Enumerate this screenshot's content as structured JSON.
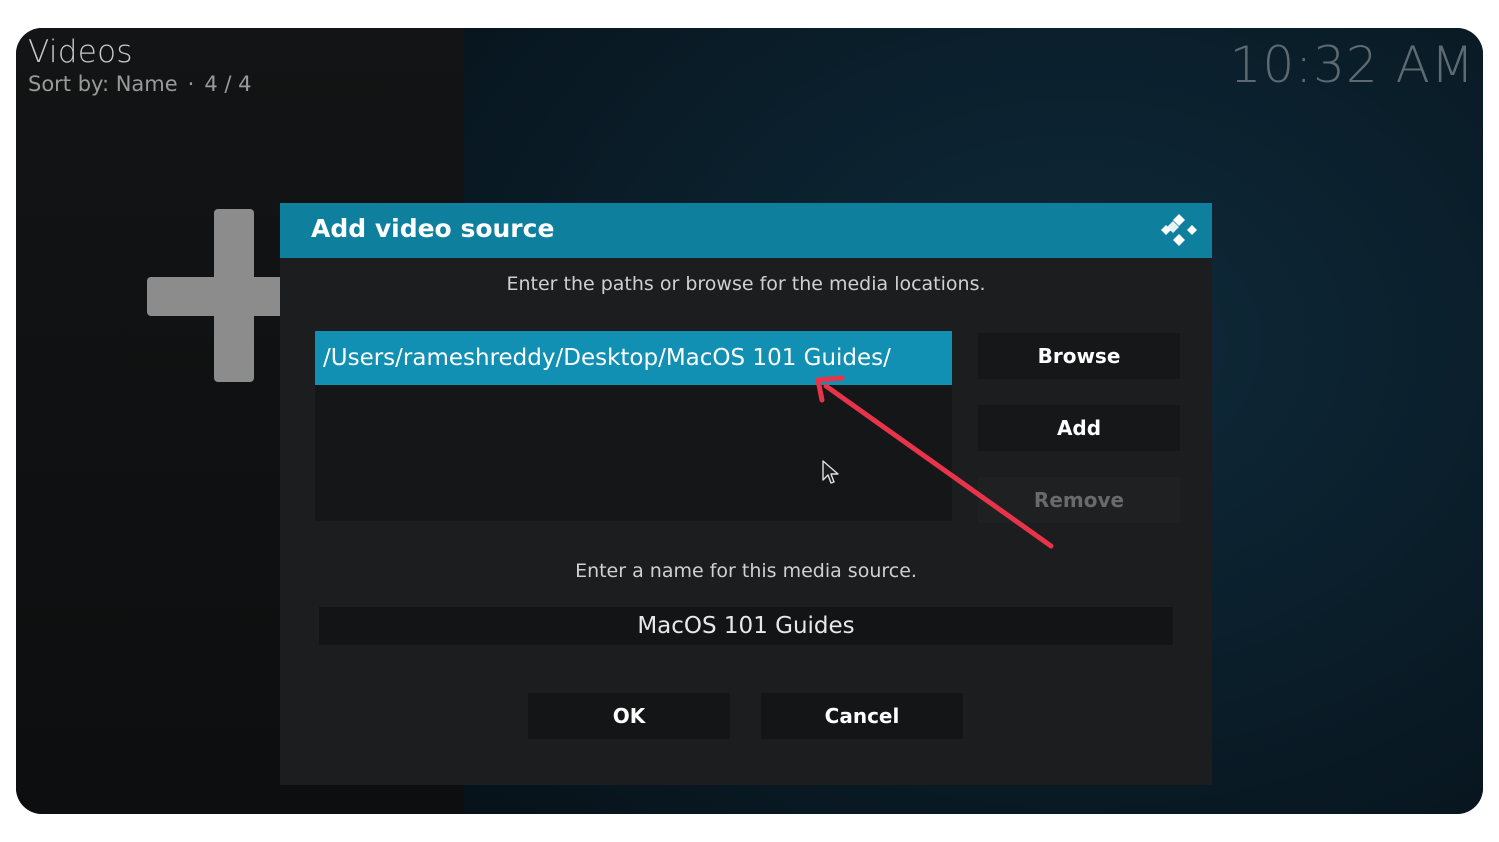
{
  "header": {
    "title": "Videos",
    "sort_label": "Sort by: Name",
    "separator": "·",
    "count": "4 / 4",
    "clock": "10:32 AM"
  },
  "dialog": {
    "title": "Add video source",
    "paths_instruction": "Enter the paths or browse for the media locations.",
    "paths": [
      "/Users/rameshreddy/Desktop/MacOS 101 Guides/"
    ],
    "browse_label": "Browse",
    "add_label": "Add",
    "remove_label": "Remove",
    "name_instruction": "Enter a name for this media source.",
    "name_value": "MacOS 101 Guides",
    "ok_label": "OK",
    "cancel_label": "Cancel"
  },
  "icons": {
    "add_source": "plus-icon",
    "logo": "kodi-logo-icon",
    "cursor": "mouse-pointer-icon",
    "annotation": "red-arrow-annotation"
  },
  "colors": {
    "accent": "#0e7f9c",
    "selected_item": "#1190b4",
    "annotation": "#e8344a"
  }
}
